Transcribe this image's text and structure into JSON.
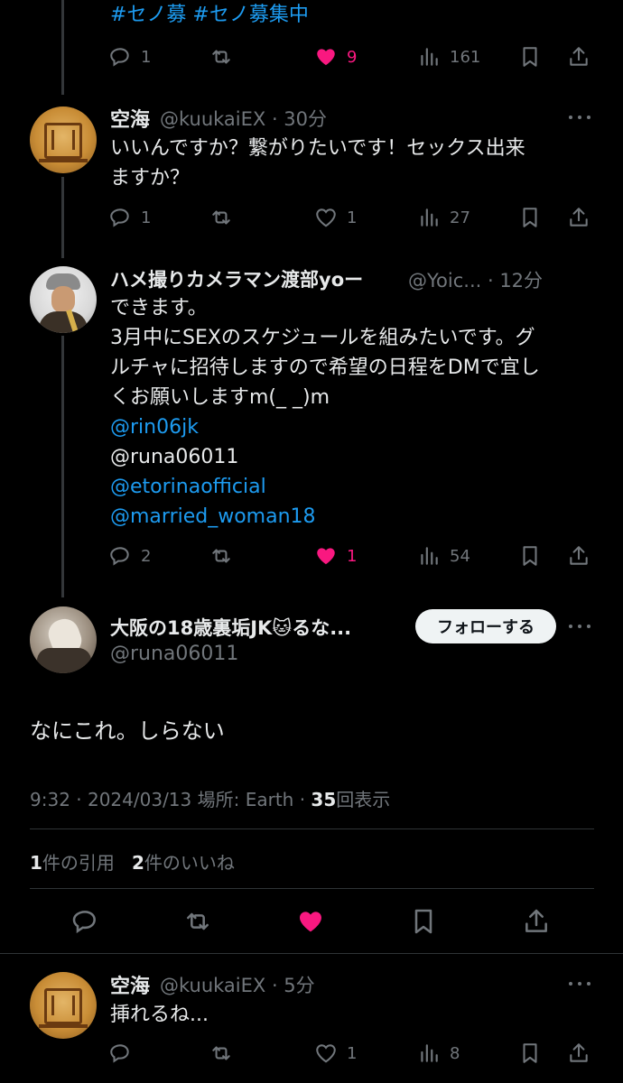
{
  "top_tweet": {
    "hashtags": "#セノ募 #セノ募集中",
    "replies": "1",
    "likes": "9",
    "views": "161"
  },
  "reply1": {
    "name": "空海",
    "handle_time": "@kuukaiEX · 30分",
    "text": "いいんですか？繋がりたいです！セックス出来\nますか？",
    "replies": "1",
    "likes": "1",
    "views": "27"
  },
  "reply2": {
    "name": "ハメ撮りカメラマン渡部yoー",
    "handle_time": "@Yoic... · 12分",
    "line1": "できます。",
    "line2": "3月中にSEXのスケジュールを組みたいです。グ",
    "line3": "ルチャに招待しますので希望の日程をDMで宜し",
    "line4": "くお願いしますm(_ _)m",
    "mention1": "@rin06jk",
    "mention2": "@runa06011",
    "mention3": "@etorinaofficial",
    "mention4": "@married_woman18",
    "replies": "2",
    "likes": "1",
    "views": "54"
  },
  "main_tweet": {
    "name": "大阪の18歳裏垢JK🐱るな...",
    "handle": "@runa06011",
    "follow_label": "フォローする",
    "text": "なにこれ。しらない",
    "time": "9:32 · 2024/03/13 場所: Earth · ",
    "views_count": "35",
    "views_label": "回表示",
    "quotes_count": "1",
    "quotes_label": "件の引用",
    "likes_count": "2",
    "likes_label": "件のいいね"
  },
  "reply3": {
    "name": "空海",
    "handle_time": "@kuukaiEX · 5分",
    "text": "挿れるね...",
    "likes": "1",
    "views": "8"
  },
  "colors": {
    "background": "#000000",
    "text": "#e7e9ea",
    "muted": "#71767b",
    "link": "#1d9bf0",
    "like_pink": "#f91880"
  }
}
